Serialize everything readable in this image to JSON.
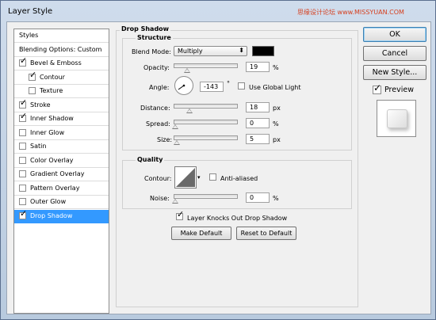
{
  "window": {
    "title": "Layer Style",
    "watermark": "思缘设计论坛 www.MISSYUAN.COM"
  },
  "styles_list": [
    {
      "label": "Styles",
      "checkbox": false,
      "checked": false,
      "indent": false,
      "selected": false
    },
    {
      "label": "Blending Options: Custom",
      "checkbox": false,
      "checked": false,
      "indent": false,
      "selected": false
    },
    {
      "label": "Bevel & Emboss",
      "checkbox": true,
      "checked": true,
      "indent": false,
      "selected": false
    },
    {
      "label": "Contour",
      "checkbox": true,
      "checked": true,
      "indent": true,
      "selected": false
    },
    {
      "label": "Texture",
      "checkbox": true,
      "checked": false,
      "indent": true,
      "selected": false
    },
    {
      "label": "Stroke",
      "checkbox": true,
      "checked": true,
      "indent": false,
      "selected": false
    },
    {
      "label": "Inner Shadow",
      "checkbox": true,
      "checked": true,
      "indent": false,
      "selected": false
    },
    {
      "label": "Inner Glow",
      "checkbox": true,
      "checked": false,
      "indent": false,
      "selected": false
    },
    {
      "label": "Satin",
      "checkbox": true,
      "checked": false,
      "indent": false,
      "selected": false
    },
    {
      "label": "Color Overlay",
      "checkbox": true,
      "checked": false,
      "indent": false,
      "selected": false
    },
    {
      "label": "Gradient Overlay",
      "checkbox": true,
      "checked": false,
      "indent": false,
      "selected": false
    },
    {
      "label": "Pattern Overlay",
      "checkbox": true,
      "checked": false,
      "indent": false,
      "selected": false
    },
    {
      "label": "Outer Glow",
      "checkbox": true,
      "checked": false,
      "indent": false,
      "selected": false
    },
    {
      "label": "Drop Shadow",
      "checkbox": true,
      "checked": true,
      "indent": false,
      "selected": true
    }
  ],
  "drop_shadow": {
    "title": "Drop Shadow",
    "structure": {
      "title": "Structure",
      "blend_mode_label": "Blend Mode:",
      "blend_mode_value": "Multiply",
      "shadow_color": "#000000",
      "opacity_label": "Opacity:",
      "opacity_value": "19",
      "opacity_unit": "%",
      "opacity_fraction": 0.19,
      "angle_label": "Angle:",
      "angle_value": "-143",
      "angle_unit": "°",
      "use_global_light_label": "Use Global Light",
      "use_global_light_checked": false,
      "distance_label": "Distance:",
      "distance_value": "18",
      "distance_unit": "px",
      "distance_fraction": 0.24,
      "spread_label": "Spread:",
      "spread_value": "0",
      "spread_unit": "%",
      "spread_fraction": 0.0,
      "size_label": "Size:",
      "size_value": "5",
      "size_unit": "px",
      "size_fraction": 0.02
    },
    "quality": {
      "title": "Quality",
      "contour_label": "Contour:",
      "anti_aliased_label": "Anti-aliased",
      "anti_aliased_checked": false,
      "noise_label": "Noise:",
      "noise_value": "0",
      "noise_unit": "%",
      "noise_fraction": 0.0
    },
    "layer_knocks_out_label": "Layer Knocks Out Drop Shadow",
    "layer_knocks_out_checked": true,
    "make_default_label": "Make Default",
    "reset_default_label": "Reset to Default"
  },
  "buttons": {
    "ok_label": "OK",
    "cancel_label": "Cancel",
    "new_style_label": "New Style...",
    "preview_label": "Preview",
    "preview_checked": true
  },
  "colors": {
    "selection": "#3399ff",
    "title_bar": "#c5d3e6"
  }
}
